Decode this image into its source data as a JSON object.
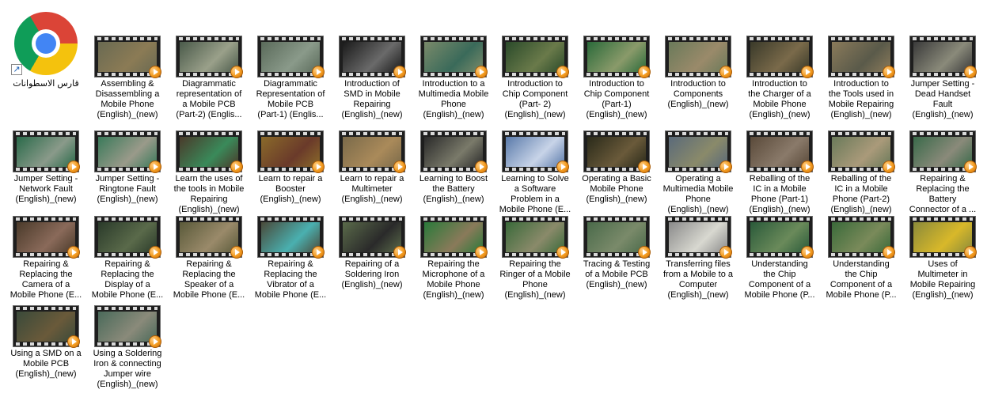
{
  "desktop": {
    "shortcut": {
      "label": "قارس الاسطوانات",
      "icon": "chrome-icon"
    },
    "files": [
      {
        "label": "Assembling &\nDisassembling a\nMobile Phone\n(English)_(new)",
        "colors": [
          "#6a6a52",
          "#8b7b55"
        ]
      },
      {
        "label": "Diagrammatic\nrepresentation of\na Mobile PCB\n(Part-2) (Englis...",
        "colors": [
          "#4a5a4a",
          "#9aa08a"
        ]
      },
      {
        "label": "Diagrammatic\nRepresentation of\nMobile PCB\n(Part-1) (Englis...",
        "colors": [
          "#5a6a5a",
          "#8a9a8a"
        ]
      },
      {
        "label": "Introduction of\nSMD in Mobile\nRepairing\n(English)_(new)",
        "colors": [
          "#1a1a1a",
          "#6a6a6a"
        ]
      },
      {
        "label": "Introduction to a\nMultimedia Mobile\nPhone\n(English)_(new)",
        "colors": [
          "#7a8a6a",
          "#3a6a5a"
        ]
      },
      {
        "label": "Introduction to\nChip Component\n(Part- 2)\n(English)_(new)",
        "colors": [
          "#2a4a2a",
          "#6a7a4a"
        ]
      },
      {
        "label": "Introduction to\nChip Component\n(Part-1)\n(English)_(new)",
        "colors": [
          "#2a6a3a",
          "#8a9a6a"
        ]
      },
      {
        "label": "Introduction to\nComponents\n(English)_(new)",
        "colors": [
          "#6a7a5a",
          "#9a8a6a"
        ]
      },
      {
        "label": "Introduction to\nthe Charger of a\nMobile Phone\n(English)_(new)",
        "colors": [
          "#3a3a2a",
          "#7a6a4a"
        ]
      },
      {
        "label": "Introduction to\nthe Tools used in\nMobile Repairing\n(English)_(new)",
        "colors": [
          "#8a7a5a",
          "#5a5a4a"
        ]
      },
      {
        "label": "Jumper Setting -\nDead Handset\nFault\n(English)_(new)",
        "colors": [
          "#3a3a3a",
          "#8a8a7a"
        ]
      },
      {
        "label": "Jumper Setting -\nNetwork Fault\n(English)_(new)",
        "colors": [
          "#2a6a4a",
          "#8a9a8a"
        ]
      },
      {
        "label": "Jumper Setting -\nRingtone Fault\n(English)_(new)",
        "colors": [
          "#3a7a5a",
          "#9a9a8a"
        ]
      },
      {
        "label": "Learn the uses of\nthe tools in Mobile\nRepairing\n(English)_(new)",
        "colors": [
          "#4a3a2a",
          "#3a8a5a"
        ]
      },
      {
        "label": "Learn to repair a\nBooster\n(English)_(new)",
        "colors": [
          "#8a6a2a",
          "#6a3a2a"
        ]
      },
      {
        "label": "Learn to repair a\nMultimeter\n(English)_(new)",
        "colors": [
          "#7a6a4a",
          "#aa8a5a"
        ]
      },
      {
        "label": "Learning to Boost\nthe Battery\n(English)_(new)",
        "colors": [
          "#2a2a2a",
          "#7a7a6a"
        ]
      },
      {
        "label": "Learning to Solve\na Software\nProblem in a\nMobile Phone (E...",
        "colors": [
          "#5a7aaa",
          "#c8d4e8"
        ]
      },
      {
        "label": "Operating a Basic\nMobile Phone\n(English)_(new)",
        "colors": [
          "#2a2a1a",
          "#6a5a3a"
        ]
      },
      {
        "label": "Operating a\nMultimedia Mobile\nPhone\n(English)_(new)",
        "colors": [
          "#5a6a7a",
          "#8a8a6a"
        ]
      },
      {
        "label": "Reballing of the\nIC in a Mobile\nPhone (Part-1)\n(English)_(new)",
        "colors": [
          "#5a4a3a",
          "#8a7a6a"
        ]
      },
      {
        "label": "Reballing of the\nIC in a Mobile\nPhone (Part-2)\n(English)_(new)",
        "colors": [
          "#6a7a5a",
          "#aa9a7a"
        ]
      },
      {
        "label": "Repairing &\nReplacing the\nBattery\nConnector of a ...",
        "colors": [
          "#3a6a4a",
          "#8a8a7a"
        ]
      },
      {
        "label": "Repairing &\nReplacing the\nCamera of a\nMobile Phone (E...",
        "colors": [
          "#4a3a2a",
          "#8a6a5a"
        ]
      },
      {
        "label": "Repairing &\nReplacing the\nDisplay of a\nMobile Phone (E...",
        "colors": [
          "#2a3a2a",
          "#5a6a4a"
        ]
      },
      {
        "label": "Repairing &\nReplacing the\nSpeaker of a\nMobile Phone (E...",
        "colors": [
          "#5a5a3a",
          "#9a8a6a"
        ]
      },
      {
        "label": "Repairing &\nReplacing the\nVibrator of a\nMobile Phone (E...",
        "colors": [
          "#4a4a3a",
          "#4ab0b0"
        ]
      },
      {
        "label": "Repairing of a\nSoldering Iron\n(English)_(new)",
        "colors": [
          "#5a6a4a",
          "#2a2a2a"
        ]
      },
      {
        "label": "Repairing the\nMicrophone of a\nMobile Phone\n(English)_(new)",
        "colors": [
          "#2a7a3a",
          "#8a7a5a"
        ]
      },
      {
        "label": "Repairing the\nRinger of a Mobile\nPhone\n(English)_(new)",
        "colors": [
          "#3a6a3a",
          "#8a8a6a"
        ]
      },
      {
        "label": "Tracing & Testing\nof a Mobile PCB\n(English)_(new)",
        "colors": [
          "#4a6a4a",
          "#7a8a6a"
        ]
      },
      {
        "label": "Transferring files\nfrom a Mobile to a\nComputer\n(English)_(new)",
        "colors": [
          "#8a8a8a",
          "#d8d8d0"
        ]
      },
      {
        "label": "Understanding\nthe Chip\nComponent of a\nMobile Phone (P...",
        "colors": [
          "#2a5a3a",
          "#6a8a5a"
        ]
      },
      {
        "label": "Understanding\nthe Chip\nComponent of a\nMobile Phone (P...",
        "colors": [
          "#3a6a3a",
          "#7a8a5a"
        ]
      },
      {
        "label": "Uses of\nMultimeter in\nMobile Repairing\n(English)_(new)",
        "colors": [
          "#8a8a3a",
          "#d8b82a"
        ]
      },
      {
        "label": "Using a SMD on a\nMobile PCB\n(English)_(new)",
        "colors": [
          "#3a4a3a",
          "#6a5a3a"
        ]
      },
      {
        "label": "Using a Soldering\nIron & connecting\nJumper wire\n(English)_(new)",
        "colors": [
          "#4a6a5a",
          "#8a8a7a"
        ]
      }
    ]
  }
}
